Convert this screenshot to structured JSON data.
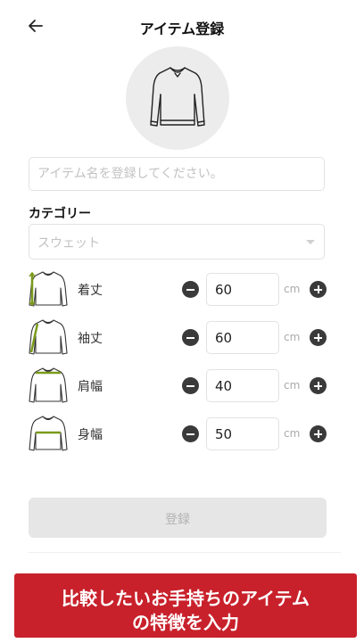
{
  "header": {
    "title": "アイテム登録",
    "back_icon": "arrow-left-icon"
  },
  "photo": {
    "icon": "sweatshirt-icon"
  },
  "item_name": {
    "placeholder": "アイテム名を登録してください。",
    "value": ""
  },
  "category": {
    "label": "カテゴリー",
    "selected": "スウェット"
  },
  "measurements": [
    {
      "label": "着丈",
      "value": "60",
      "unit": "cm",
      "icon": "sweatshirt-length-icon"
    },
    {
      "label": "袖丈",
      "value": "60",
      "unit": "cm",
      "icon": "sweatshirt-sleeve-icon"
    },
    {
      "label": "肩幅",
      "value": "40",
      "unit": "cm",
      "icon": "sweatshirt-shoulder-icon"
    },
    {
      "label": "身幅",
      "value": "50",
      "unit": "cm",
      "icon": "sweatshirt-chest-icon"
    }
  ],
  "submit": {
    "label": "登録"
  },
  "banner": {
    "line1": "比較したいお手持ちのアイテム",
    "line2": "の特徴を入力"
  },
  "colors": {
    "accent_green": "#7a9a1a",
    "banner_red": "#c8212b",
    "control_dark": "#3a3a3a"
  }
}
